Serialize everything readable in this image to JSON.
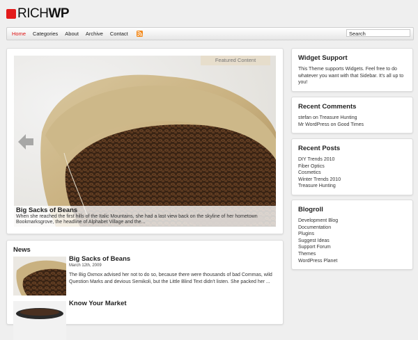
{
  "logo": {
    "part1": "RICH",
    "part2": "WP"
  },
  "nav": {
    "items": [
      {
        "label": "Home"
      },
      {
        "label": "Categories"
      },
      {
        "label": "About"
      },
      {
        "label": "Archive"
      },
      {
        "label": "Contact"
      }
    ],
    "search_value": "Search"
  },
  "featured": {
    "label": "Featured Content",
    "title": "Big Sacks of Beans",
    "text": "When she reached the first hills of the Italic Mountains, she had a last view back on the skyline of her hometown Bookmarksgrove, the headline of Alphabet Village and the..."
  },
  "news": {
    "heading": "News",
    "items": [
      {
        "title": "Big Sacks of Beans",
        "date": "March 12th, 2009",
        "excerpt": "The Big Oxmox advised her not to do so, because there were thousands of bad Commas, wild Question Marks and devious Semikoli, but the Little Blind Text didn't listen. She packed her ..."
      },
      {
        "title": "Know Your Market",
        "date": "",
        "excerpt": ""
      }
    ]
  },
  "sidebar": {
    "widget_support": {
      "title": "Widget Support",
      "text": "This Theme supports Widgets. Feel free to do whatever you want with that Sidebar. It's all up to you!"
    },
    "recent_comments": {
      "title": "Recent Comments",
      "items": [
        {
          "author": "stefan",
          "on": "on",
          "post": "Treasure Hunting"
        },
        {
          "author": "Mr WordPress",
          "on": "on",
          "post": "Good Times"
        }
      ]
    },
    "recent_posts": {
      "title": "Recent Posts",
      "items": [
        "DIY Trends 2010",
        "Fiber Optics",
        "Cosmetics",
        "Winter Trends 2010",
        "Treasure Hunting"
      ]
    },
    "blogroll": {
      "title": "Blogroll",
      "items": [
        "Development Blog",
        "Documentation",
        "Plugins",
        "Suggest Ideas",
        "Support Forum",
        "Themes",
        "WordPress Planet"
      ]
    }
  },
  "colors": {
    "accent": "#e31b1b",
    "rss": "#f28a1d",
    "background": "#efefef"
  },
  "icons": {
    "rss": "rss-feed-icon",
    "prev": "arrow-left-icon"
  }
}
